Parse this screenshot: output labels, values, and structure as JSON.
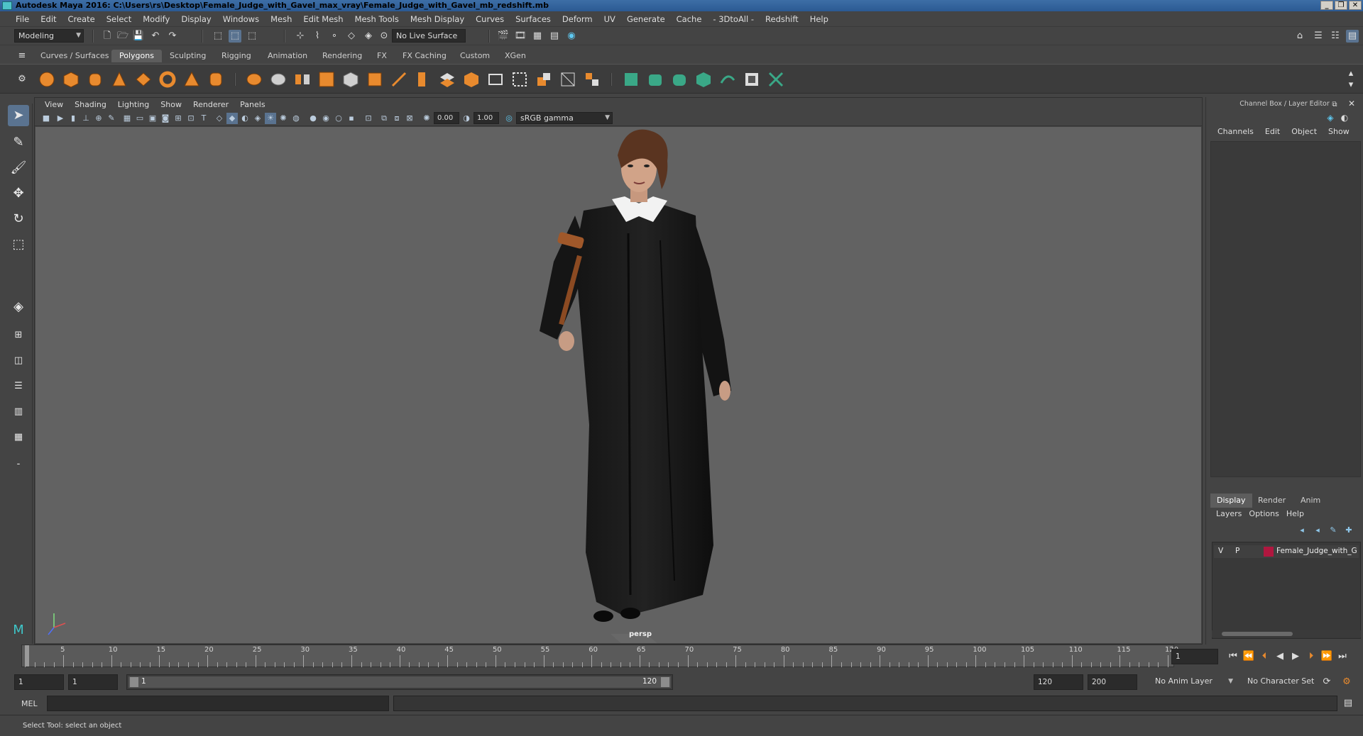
{
  "window": {
    "title": "Autodesk Maya 2016: C:\\Users\\rs\\Desktop\\Female_Judge_with_Gavel_max_vray\\Female_Judge_with_Gavel_mb_redshift.mb",
    "controls": [
      "_",
      "❐",
      "✕"
    ]
  },
  "menubar": [
    "File",
    "Edit",
    "Create",
    "Select",
    "Modify",
    "Display",
    "Windows",
    "Mesh",
    "Edit Mesh",
    "Mesh Tools",
    "Mesh Display",
    "Curves",
    "Surfaces",
    "Deform",
    "UV",
    "Generate",
    "Cache",
    "- 3DtoAll -",
    "Redshift",
    "Help"
  ],
  "statusline": {
    "mode": "Modeling",
    "live_surface": "No Live Surface"
  },
  "shelf": {
    "tabs": [
      "Curves / Surfaces",
      "Polygons",
      "Sculpting",
      "Rigging",
      "Animation",
      "Rendering",
      "FX",
      "FX Caching",
      "Custom",
      "XGen"
    ],
    "active_tab": "Polygons"
  },
  "viewport": {
    "menu": [
      "View",
      "Shading",
      "Lighting",
      "Show",
      "Renderer",
      "Panels"
    ],
    "exposure": "0.00",
    "gamma": "1.00",
    "color_space": "sRGB gamma",
    "camera_label": "persp"
  },
  "channel_box": {
    "title": "Channel Box / Layer Editor",
    "menu": [
      "Channels",
      "Edit",
      "Object",
      "Show"
    ],
    "layer_tabs": [
      "Display",
      "Render",
      "Anim"
    ],
    "active_layer_tab": "Display",
    "layer_menu": [
      "Layers",
      "Options",
      "Help"
    ],
    "layer": {
      "v": "V",
      "p": "P",
      "name": "Female_Judge_with_G",
      "color": "#b0173f"
    }
  },
  "timeline": {
    "ticks": [
      "5",
      "10",
      "15",
      "20",
      "25",
      "30",
      "35",
      "40",
      "45",
      "50",
      "55",
      "60",
      "65",
      "70",
      "75",
      "80",
      "85",
      "90",
      "95",
      "100",
      "105",
      "110",
      "115",
      "120"
    ],
    "first_label": "1",
    "current_frame": "1"
  },
  "range": {
    "start": "1",
    "playback_start": "1",
    "slider_start": "1",
    "slider_end": "120",
    "playback_end": "120",
    "end": "200",
    "anim_layer": "No Anim Layer",
    "character_set": "No Character Set"
  },
  "command": {
    "lang": "MEL"
  },
  "help": {
    "text": "Select Tool: select an object"
  }
}
